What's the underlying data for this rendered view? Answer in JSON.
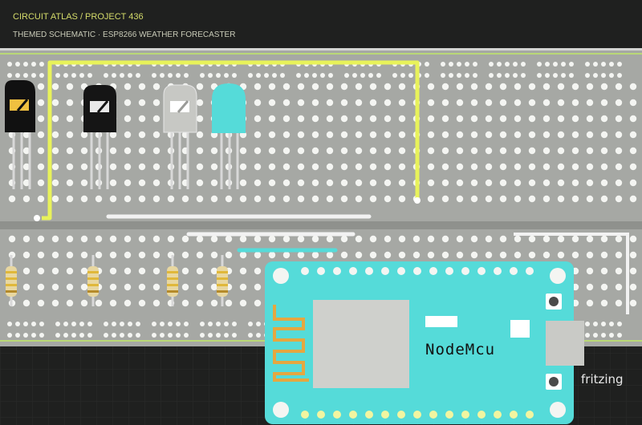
{
  "header": {
    "breadcrumb": "CIRCUIT ATLAS / PROJECT 436",
    "subtitle": "THEMED SCHEMATIC · ESP8266 WEATHER FORECASTER"
  },
  "board": {
    "label": "NodeMcu"
  },
  "watermark": "fritzing",
  "colors": {
    "background": "#1f201f",
    "breadboard": "#a6a8a4",
    "hole": "#f4f5f2",
    "wire_yellow": "#e8f25a",
    "wire_white": "#f2f2f2",
    "nodemcu": "#55dbd9",
    "header_text": "#d5dc6a",
    "subtitle_text": "#c9cbb8"
  }
}
